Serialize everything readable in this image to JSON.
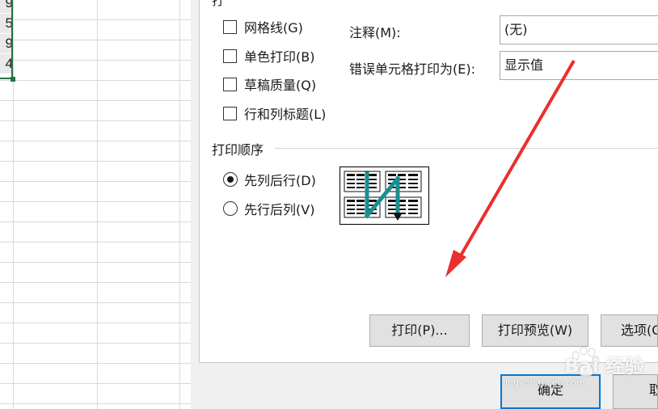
{
  "sheet": {
    "cells": [
      "9",
      "5",
      "9",
      "4"
    ]
  },
  "section_cut_label": "打",
  "print_options": {
    "gridlines": {
      "label": "网格线(G)",
      "checked": false
    },
    "black_white": {
      "label": "单色打印(B)",
      "checked": false
    },
    "draft_quality": {
      "label": "草稿质量(Q)",
      "checked": false
    },
    "row_col_headings": {
      "label": "行和列标题(L)",
      "checked": false
    }
  },
  "comments": {
    "label": "注释(M):",
    "value": "(无)"
  },
  "cell_errors": {
    "label": "错误单元格打印为(E):",
    "value": "显示值"
  },
  "page_order": {
    "title": "打印顺序",
    "down_then_over": {
      "label": "先列后行(D)",
      "selected": true
    },
    "over_then_down": {
      "label": "先行后列(V)",
      "selected": false
    }
  },
  "buttons": {
    "print": "打印(P)...",
    "print_preview": "打印预览(W)",
    "options": "选项(O)",
    "ok": "确定",
    "cancel": "取"
  },
  "watermark": {
    "brand": "Bai 经验",
    "url": "jingyan.baidu.com"
  },
  "colors": {
    "accent": "#0078d7",
    "selection": "#217346",
    "annotation_arrow": "#e8302e",
    "order_arrow": "#1a8f8f"
  }
}
